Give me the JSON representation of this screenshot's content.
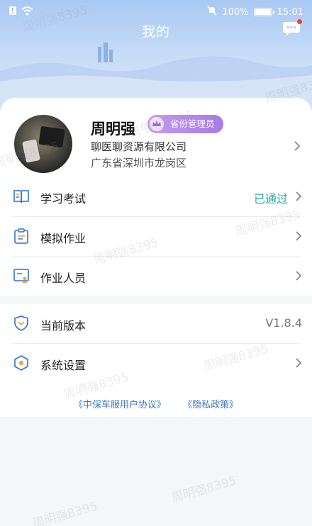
{
  "status_bar": {
    "battery": "100%",
    "time": "15:01",
    "battery_level": 1.0
  },
  "header": {
    "title": "我的"
  },
  "profile": {
    "name": "周明强",
    "role": "省份管理员",
    "company": "聊医聊资源有限公司",
    "location": "广东省深圳市龙岗区"
  },
  "menu": [
    {
      "label": "学习考试",
      "value": "已通过",
      "value_color": "#2aa6a6"
    },
    {
      "label": "模拟作业",
      "value": ""
    },
    {
      "label": "作业人员",
      "value": ""
    },
    {
      "label": "当前版本",
      "value": "V1.8.4",
      "value_color": "#777777"
    },
    {
      "label": "系统设置",
      "value": ""
    }
  ],
  "links": {
    "agreement": "《中保车服用户协议》",
    "privacy": "《隐私政策》"
  },
  "watermark": "周明强8395",
  "colors": {
    "accent": "#3a79c9",
    "badge": "#b38aea",
    "passed": "#2aa6a6"
  }
}
